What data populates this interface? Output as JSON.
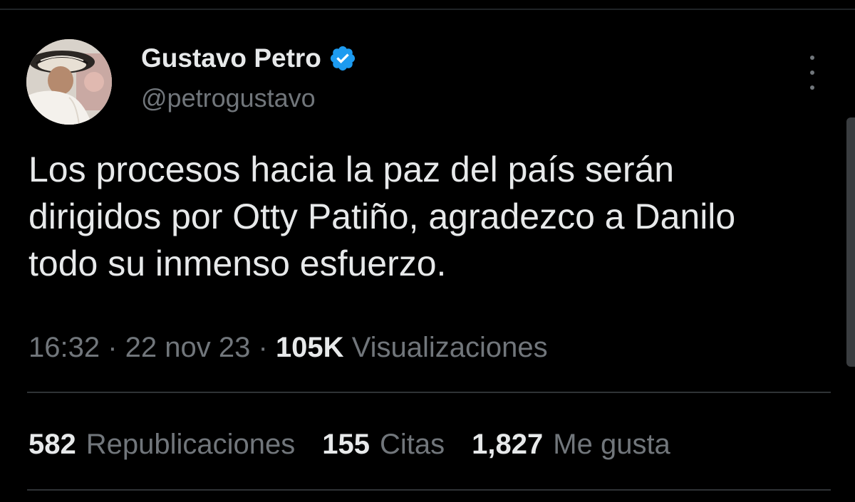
{
  "author": {
    "display_name": "Gustavo Petro",
    "handle": "@petrogustavo",
    "verified_icon": "verified-badge-icon",
    "avatar_icon": "avatar-photo"
  },
  "tweet": {
    "text": "Los procesos hacia la paz del país serán dirigidos por Otty Patiño, agradezco a Danilo todo su inmenso esfuerzo."
  },
  "meta": {
    "time": "16:32",
    "separator": "·",
    "date": "22 nov 23",
    "views_count": "105K",
    "views_label": "Visualizaciones"
  },
  "stats": {
    "reposts_count": "582",
    "reposts_label": "Republicaciones",
    "quotes_count": "155",
    "quotes_label": "Citas",
    "likes_count": "1,827",
    "likes_label": "Me gusta"
  },
  "colors": {
    "background": "#000000",
    "primary_text": "#e7e9ea",
    "secondary_text": "#71767b",
    "verified_blue": "#1d9bf0",
    "divider": "#2f3336"
  }
}
